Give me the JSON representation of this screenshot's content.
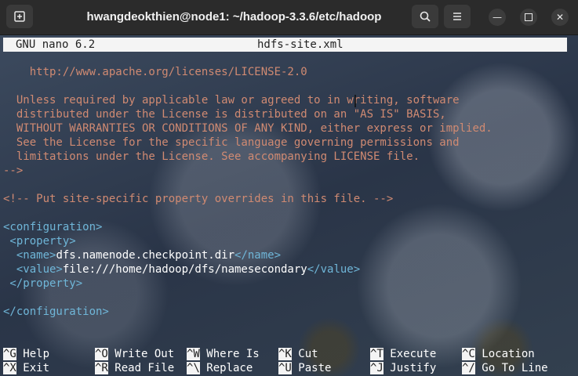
{
  "window": {
    "title": "hwangdeokthien@node1: ~/hadoop-3.3.6/etc/hadoop",
    "new_tab_icon": "terminal-tab-icon",
    "search_icon": "search-icon",
    "menu_icon": "hamburger-menu-icon"
  },
  "nano": {
    "version": "GNU nano 6.2",
    "filename": "hdfs-site.xml"
  },
  "content": {
    "l1": "    http://www.apache.org/licenses/LICENSE-2.0",
    "l2": "  Unless required by applicable law or agreed to in writing, software",
    "l3": "  distributed under the License is distributed on an \"AS IS\" BASIS,",
    "l4": "  WITHOUT WARRANTIES OR CONDITIONS OF ANY KIND, either express or implied.",
    "l5": "  See the License for the specific language governing permissions and",
    "l6": "  limitations under the License. See accompanying LICENSE file.",
    "l7": "-->",
    "l8": "<!-- Put site-specific property overrides in this file. -->",
    "config_open": "<configuration>",
    "property_open": " <property>",
    "name_open": "  <name>",
    "name_value": "dfs.namenode.checkpoint.dir",
    "name_close": "</name>",
    "value_open": "  <value>",
    "value_value": "file:///home/hadoop/dfs/namesecondary",
    "value_close": "</value>",
    "property_close": " </property>",
    "config_close": "</configuration>"
  },
  "shortcuts": [
    {
      "key": "^G",
      "label": " Help"
    },
    {
      "key": "^X",
      "label": " Exit"
    },
    {
      "key": "^O",
      "label": " Write Out"
    },
    {
      "key": "^R",
      "label": " Read File"
    },
    {
      "key": "^W",
      "label": " Where Is"
    },
    {
      "key": "^\\",
      "label": " Replace"
    },
    {
      "key": "^K",
      "label": " Cut"
    },
    {
      "key": "^U",
      "label": " Paste"
    },
    {
      "key": "^T",
      "label": " Execute"
    },
    {
      "key": "^J",
      "label": " Justify"
    },
    {
      "key": "^C",
      "label": " Location"
    },
    {
      "key": "^/",
      "label": " Go To Line"
    }
  ]
}
